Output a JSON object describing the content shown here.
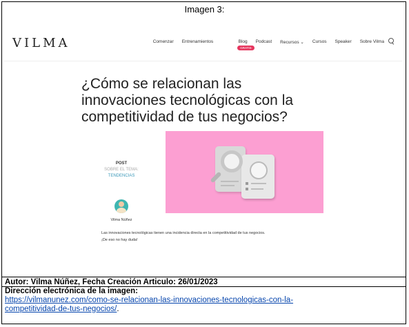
{
  "caption": "Imagen 3:",
  "site": {
    "logo": "VILMA",
    "menu": [
      "Comenzar",
      "Entrenamientos",
      "Blog",
      "Podcast",
      "Recursos ⌄",
      "Cursos",
      "Speaker",
      "Sobre Vilma"
    ],
    "badge": "GRATIS",
    "headline": "¿Cómo se relacionan las innovaciones tecnológicas con la competitividad de tus negocios?",
    "meta": {
      "post": "POST",
      "about": "SOBRE EL TEMA:",
      "category": "TENDENCIAS"
    },
    "author_name": "Vilma Núñez",
    "body_line1": "Las innovaciones tecnológicas tienen una incidencia directa en la competitividad de tus negocios.",
    "body_line2": "¡De eso no hay duda!",
    "colors": {
      "hero_bg": "#fc9fd2",
      "badge": "#e6365e",
      "category": "#3a98b9"
    }
  },
  "footer": {
    "author_line": "Autor: Vilma Núñez, Fecha Creación Articulo: 26/01/2023",
    "url_label": "Dirección electrónica de la imagen:",
    "url_line1": "https://vilmanunez.com/como-se-relacionan-las-innovaciones-tecnologicas-con-la-",
    "url_line2": "competitividad-de-tus-negocios/"
  }
}
